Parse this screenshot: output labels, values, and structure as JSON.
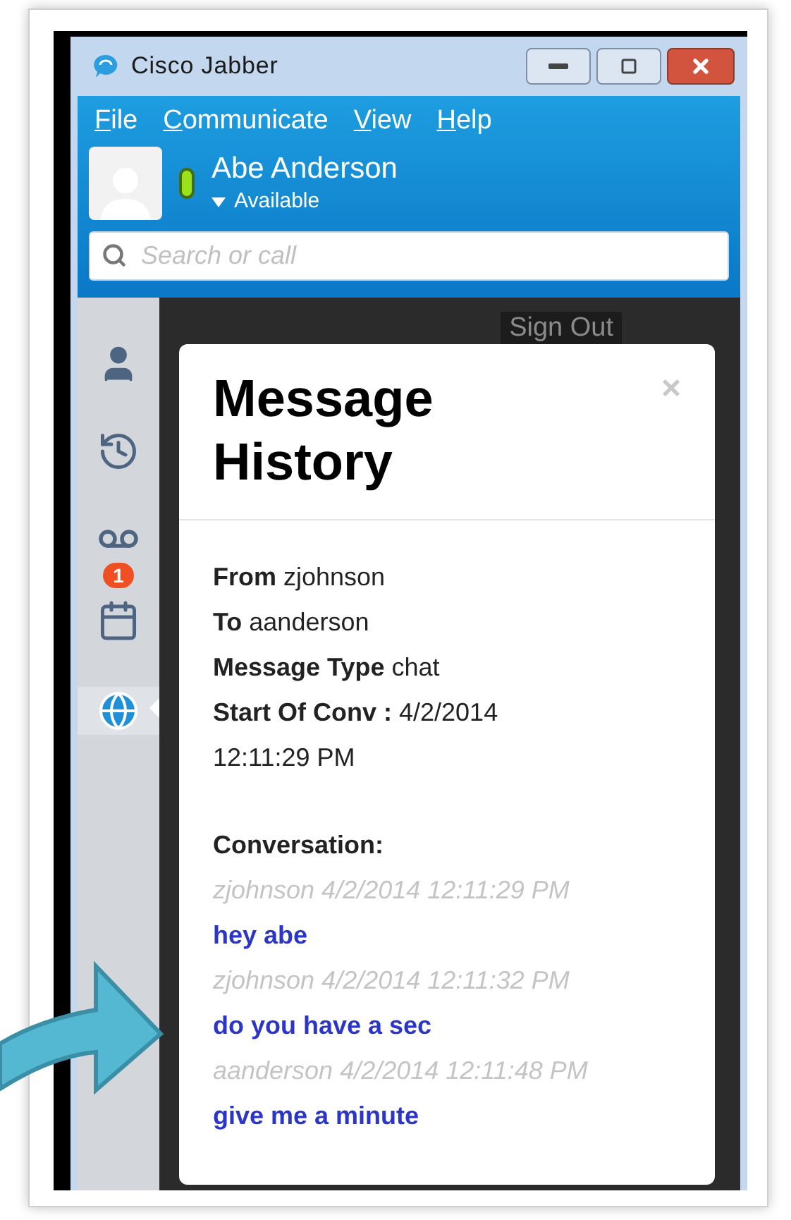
{
  "window": {
    "title": "Cisco Jabber"
  },
  "menu": [
    {
      "label": "File"
    },
    {
      "label": "Communicate"
    },
    {
      "label": "View"
    },
    {
      "label": "Help"
    }
  ],
  "user": {
    "name": "Abe Anderson",
    "status": "Available",
    "color": "#9be21c"
  },
  "search": {
    "placeholder": "Search or call"
  },
  "sidebar": {
    "items": [
      {
        "kind": "contacts",
        "selected": false
      },
      {
        "kind": "history",
        "selected": false
      },
      {
        "kind": "voicemail",
        "selected": false,
        "badge": "1"
      },
      {
        "kind": "calendar",
        "selected": false
      },
      {
        "kind": "web",
        "selected": true
      }
    ]
  },
  "sign_out": "Sign Out",
  "dialog": {
    "title": "Message History",
    "close": "×",
    "fields": [
      "**From** zjohnson",
      "**To** aanderson",
      "**Message Type** chat",
      "**Start Of Conv :** 4/2/2014 12:11:29 PM"
    ],
    "conversation_label": "Conversation:",
    "messages": [
      {
        "meta": "zjohnson 4/2/2014 12:11:29 PM",
        "text": "hey abe"
      },
      {
        "meta": "zjohnson 4/2/2014 12:11:32 PM",
        "text": "do you have a sec"
      },
      {
        "meta": "aanderson 4/2/2014 12:11:48 PM",
        "text": "give me a minute"
      }
    ]
  }
}
